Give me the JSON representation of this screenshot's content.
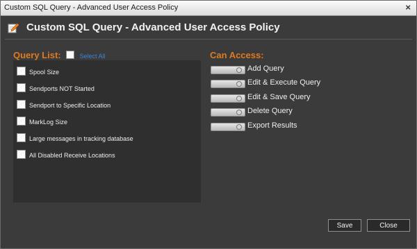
{
  "window": {
    "title": "Custom SQL Query - Advanced User Access Policy",
    "close_glyph": "×"
  },
  "header": {
    "icon": "edit-document-icon",
    "title": "Custom SQL Query - Advanced User Access Policy"
  },
  "query_list": {
    "label": "Query List:",
    "select_all_label": "Select All",
    "select_all_checked": false,
    "items": [
      {
        "label": "Spool Size",
        "checked": false
      },
      {
        "label": "Sendports NOT Started",
        "checked": false
      },
      {
        "label": "Sendport to Specific Location",
        "checked": false
      },
      {
        "label": "MarkLog Size",
        "checked": false
      },
      {
        "label": "Large messages in tracking database",
        "checked": false
      },
      {
        "label": "All Disabled Receive Locations",
        "checked": false
      }
    ]
  },
  "can_access": {
    "label": "Can Access:",
    "permissions": [
      {
        "label": "Add Query",
        "enabled": false
      },
      {
        "label": "Edit & Execute Query",
        "enabled": false
      },
      {
        "label": "Edit & Save Query",
        "enabled": false
      },
      {
        "label": "Delete Query",
        "enabled": false
      },
      {
        "label": "Export Results",
        "enabled": false
      }
    ]
  },
  "buttons": {
    "save_label": "Save",
    "close_label": "Close"
  },
  "colors": {
    "background": "#3b3b3b",
    "list_background": "#2f2f2f",
    "section_accent": "#e07a1f",
    "link": "#3b86d6",
    "text": "#eeeeee"
  }
}
